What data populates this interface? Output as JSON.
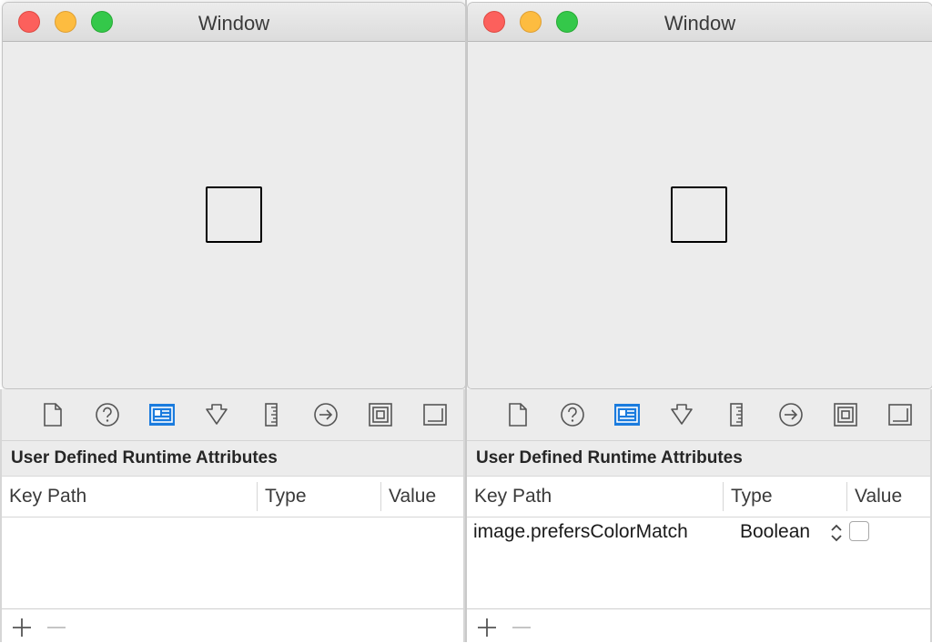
{
  "panels": [
    {
      "window_title": "Window",
      "section_title": "User Defined Runtime Attributes",
      "columns": [
        "Key Path",
        "Type",
        "Value"
      ],
      "rows": []
    },
    {
      "window_title": "Window",
      "section_title": "User Defined Runtime Attributes",
      "columns": [
        "Key Path",
        "Type",
        "Value"
      ],
      "rows": [
        {
          "key_path": "image.prefersColorMatch",
          "type": "Boolean",
          "value_checked": false
        }
      ]
    }
  ],
  "toolbar_icons": [
    "file-icon",
    "help-icon",
    "identity-inspector-icon",
    "attributes-inspector-icon",
    "size-inspector-icon",
    "connections-inspector-icon",
    "bindings-inspector-icon",
    "view-effects-icon"
  ],
  "selected_toolbar_icon": "identity-inspector-icon",
  "colors": {
    "accent": "#1a7bde",
    "close": "#fc605c",
    "minimize": "#fdbc40",
    "zoom": "#34c84a"
  }
}
